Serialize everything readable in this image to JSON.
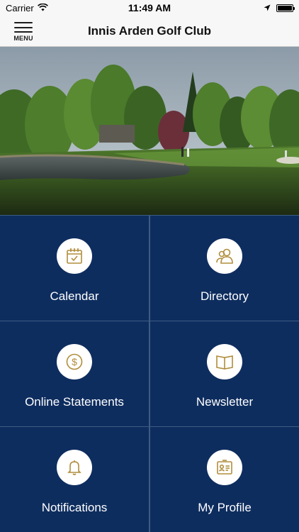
{
  "status_bar": {
    "carrier": "Carrier",
    "time": "11:49 AM"
  },
  "nav": {
    "menu_label": "MENU",
    "title": "Innis Arden Golf Club"
  },
  "tiles": [
    {
      "label": "Calendar",
      "icon": "calendar-icon"
    },
    {
      "label": "Directory",
      "icon": "people-icon"
    },
    {
      "label": "Online Statements",
      "icon": "dollar-icon"
    },
    {
      "label": "Newsletter",
      "icon": "book-icon"
    },
    {
      "label": "Notifications",
      "icon": "bell-icon"
    },
    {
      "label": "My Profile",
      "icon": "profile-card-icon"
    }
  ],
  "colors": {
    "tile_background": "#0e2d5f",
    "grid_lines": "#3d5c82",
    "icon_gold": "#b08d3c",
    "nav_background": "#f7f7f7"
  }
}
